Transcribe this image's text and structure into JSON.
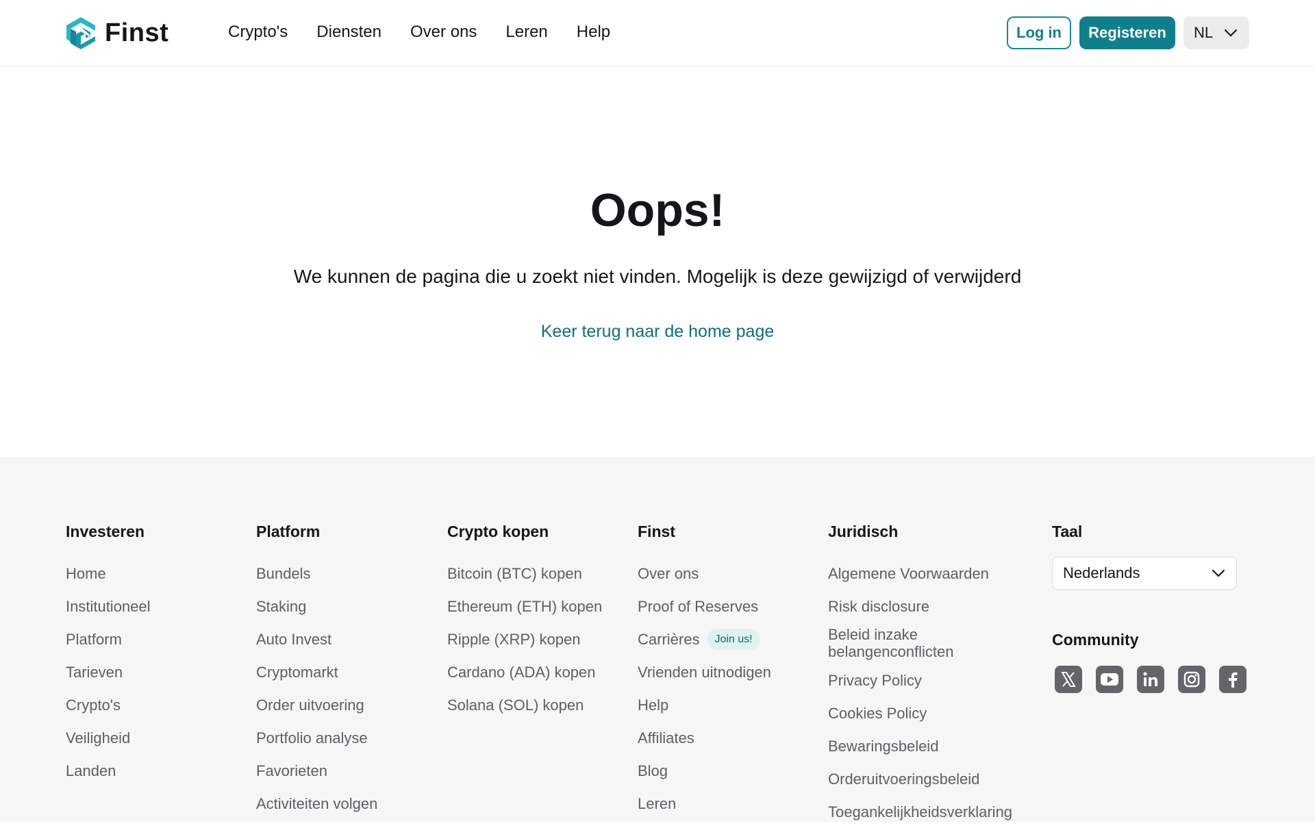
{
  "header": {
    "logo_text": "Finst",
    "nav": [
      "Crypto's",
      "Diensten",
      "Over ons",
      "Leren",
      "Help"
    ],
    "login_label": "Log in",
    "register_label": "Registeren",
    "language": "NL"
  },
  "main": {
    "title": "Oops!",
    "subtitle": "We kunnen de pagina die u zoekt niet vinden. Mogelijk is deze gewijzigd of verwijderd",
    "home_link": "Keer terug naar de home page"
  },
  "footer": {
    "investeren": {
      "title": "Investeren",
      "links": [
        "Home",
        "Institutioneel",
        "Platform",
        "Tarieven",
        "Crypto's",
        "Veiligheid",
        "Landen"
      ]
    },
    "platform": {
      "title": "Platform",
      "links": [
        "Bundels",
        "Staking",
        "Auto Invest",
        "Cryptomarkt",
        "Order uitvoering",
        "Portfolio analyse",
        "Favorieten",
        "Activiteiten volgen"
      ]
    },
    "crypto_kopen": {
      "title": "Crypto kopen",
      "links": [
        "Bitcoin (BTC) kopen",
        "Ethereum (ETH) kopen",
        "Ripple (XRP) kopen",
        "Cardano (ADA) kopen",
        "Solana (SOL) kopen"
      ]
    },
    "finst": {
      "title": "Finst",
      "links": [
        "Over ons",
        "Proof of Reserves",
        "Carrières",
        "Vrienden uitnodigen",
        "Help",
        "Affiliates",
        "Blog",
        "Leren"
      ],
      "careers_badge": "Join us!"
    },
    "juridisch": {
      "title": "Juridisch",
      "links": [
        "Algemene Voorwaarden",
        "Risk disclosure",
        "Beleid inzake belangenconflicten",
        "Privacy Policy",
        "Cookies Policy",
        "Bewaringsbeleid",
        "Orderuitvoeringsbeleid",
        "Toegankelijkheidsverklaring"
      ]
    },
    "taal": {
      "title": "Taal",
      "selected": "Nederlands"
    },
    "community": {
      "title": "Community",
      "icons": [
        "x-icon",
        "youtube-icon",
        "linkedin-icon",
        "instagram-icon",
        "facebook-icon"
      ]
    }
  },
  "colors": {
    "brand": "#0f7f8e",
    "link": "#0f6f7c",
    "footer_bg": "#f6f6f6"
  }
}
